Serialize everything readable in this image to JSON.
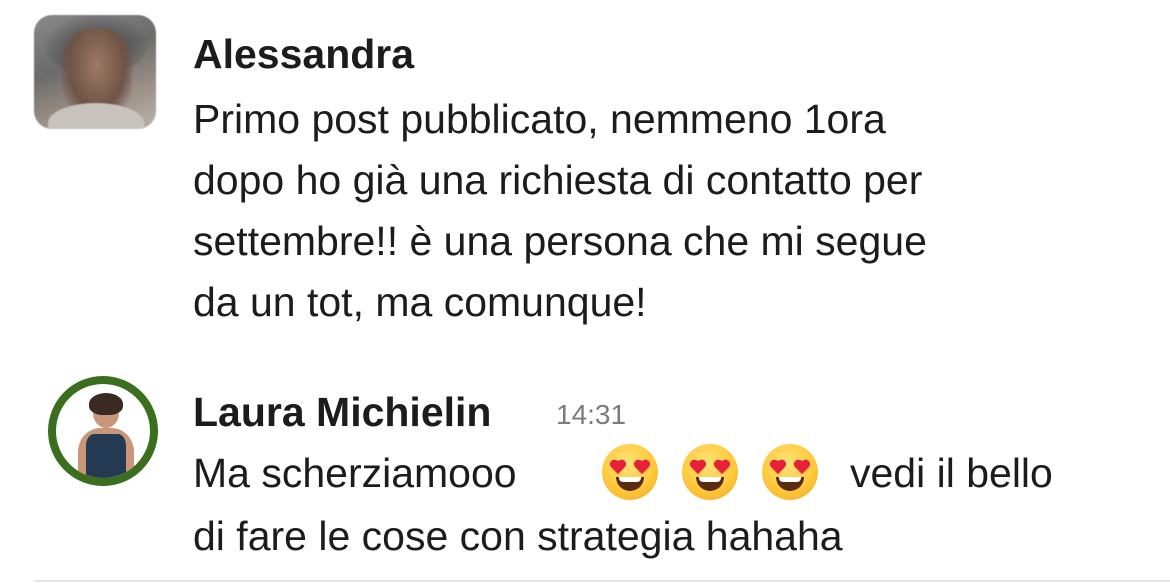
{
  "messages": [
    {
      "author": "Alessandra",
      "timestamp": "",
      "avatar": "blurred-photo",
      "lines": [
        "Primo post pubblicato, nemmeno 1ora",
        "dopo ho già una richiesta di contatto per",
        "settembre!! è una persona che mi segue",
        "da un tot, ma comunque!"
      ]
    },
    {
      "author": "Laura Michielin",
      "timestamp": "14:31",
      "avatar": "profile-photo",
      "avatar_ring_color": "#3b6e1f",
      "line1_before_emoji": "Ma scherziamooo",
      "emojis": [
        "heart-eyes-emoji",
        "heart-eyes-emoji",
        "heart-eyes-emoji"
      ],
      "line1_after_emoji": "vedi il bello",
      "line2": "di fare le cose con strategia hahaha"
    }
  ],
  "colors": {
    "text": "#1d1c1d",
    "timestamp": "#7b7b7b",
    "background": "#ffffff"
  }
}
